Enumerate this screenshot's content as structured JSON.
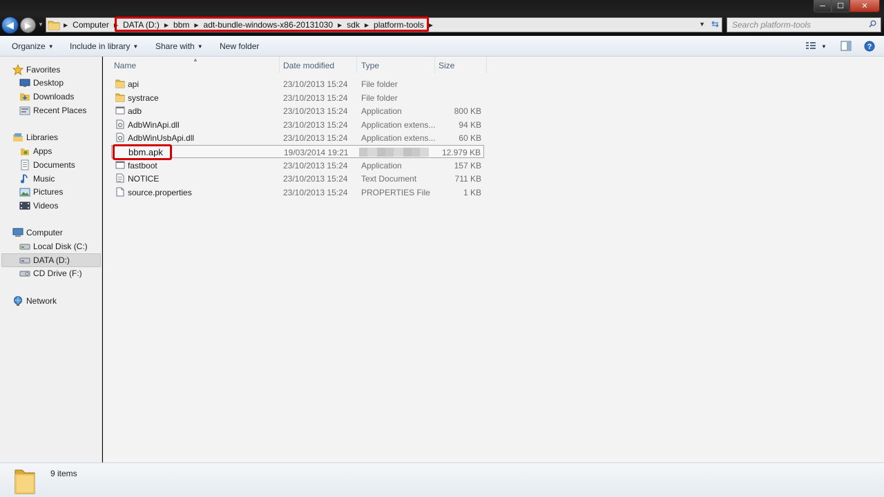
{
  "window": {
    "controls": {
      "minimize": "─",
      "maximize": "☐",
      "close": "✕"
    }
  },
  "nav": {
    "back": "◀",
    "forward": "▶",
    "dropdown": "▼"
  },
  "address": {
    "crumbs": [
      "Computer",
      "DATA (D:)",
      "bbm",
      "adt-bundle-windows-x86-20131030",
      "sdk",
      "platform-tools"
    ],
    "separator": "▶",
    "highlight_color": "#d40000"
  },
  "search": {
    "placeholder": "Search platform-tools"
  },
  "toolbar": {
    "organize": "Organize",
    "include_in_library": "Include in library",
    "share_with": "Share with",
    "new_folder": "New folder",
    "caret": "▼"
  },
  "sidebar": {
    "favorites": {
      "label": "Favorites",
      "items": [
        "Desktop",
        "Downloads",
        "Recent Places"
      ]
    },
    "libraries": {
      "label": "Libraries",
      "items": [
        "Apps",
        "Documents",
        "Music",
        "Pictures",
        "Videos"
      ]
    },
    "computer": {
      "label": "Computer",
      "items": [
        "Local Disk (C:)",
        "DATA (D:)",
        "CD Drive (F:)"
      ],
      "selected": "DATA (D:)"
    },
    "network": {
      "label": "Network"
    }
  },
  "columns": {
    "name": "Name",
    "date": "Date modified",
    "type": "Type",
    "size": "Size"
  },
  "files": [
    {
      "name": "api",
      "date": "23/10/2013 15:24",
      "type": "File folder",
      "size": "",
      "icon": "folder-icon"
    },
    {
      "name": "systrace",
      "date": "23/10/2013 15:24",
      "type": "File folder",
      "size": "",
      "icon": "folder-icon"
    },
    {
      "name": "adb",
      "date": "23/10/2013 15:24",
      "type": "Application",
      "size": "800 KB",
      "icon": "application-icon"
    },
    {
      "name": "AdbWinApi.dll",
      "date": "23/10/2013 15:24",
      "type": "Application extens...",
      "size": "94 KB",
      "icon": "dll-icon"
    },
    {
      "name": "AdbWinUsbApi.dll",
      "date": "23/10/2013 15:24",
      "type": "Application extens...",
      "size": "60 KB",
      "icon": "dll-icon"
    },
    {
      "name": "bbm.apk",
      "date": "19/03/2014 19:21",
      "type": "",
      "size": "12.979 KB",
      "icon": "apk-file-icon",
      "selected": true
    },
    {
      "name": "fastboot",
      "date": "23/10/2013 15:24",
      "type": "Application",
      "size": "157 KB",
      "icon": "application-icon"
    },
    {
      "name": "NOTICE",
      "date": "23/10/2013 15:24",
      "type": "Text Document",
      "size": "711 KB",
      "icon": "text-document-icon"
    },
    {
      "name": "source.properties",
      "date": "23/10/2013 15:24",
      "type": "PROPERTIES File",
      "size": "1 KB",
      "icon": "generic-file-icon"
    }
  ],
  "status": {
    "item_count": "9 items"
  }
}
